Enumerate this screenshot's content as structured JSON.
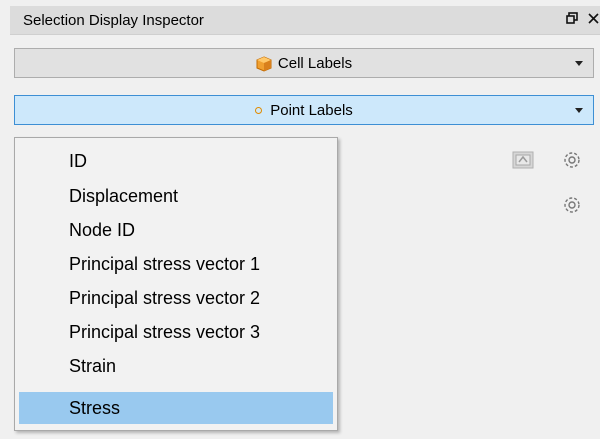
{
  "panel": {
    "title": "Selection Display Inspector"
  },
  "title_buttons": {
    "float_icon": "float-window-icon",
    "close_icon": "close-icon"
  },
  "cell_labels": {
    "label": "Cell Labels",
    "icon": "cell-cube-icon"
  },
  "point_labels": {
    "label": "Point Labels",
    "icon": "point-ring-icon"
  },
  "menu": {
    "items": [
      {
        "label": "ID"
      },
      {
        "label": "Displacement"
      },
      {
        "label": "Node ID"
      },
      {
        "label": "Principal stress vector 1"
      },
      {
        "label": "Principal stress vector 2"
      },
      {
        "label": "Principal stress vector 3"
      },
      {
        "label": "Strain"
      },
      {
        "label": "Stress"
      }
    ],
    "selected": "Stress"
  },
  "side_buttons": {
    "icons": [
      "label-style-icon",
      "gear-icon",
      "gear-icon"
    ]
  },
  "colors": {
    "accent_selected": "#99c9ef",
    "point_dropdown_bg": "#cde8fb",
    "point_dropdown_border": "#3d8fd4",
    "cube_orange": "#f0a030"
  }
}
